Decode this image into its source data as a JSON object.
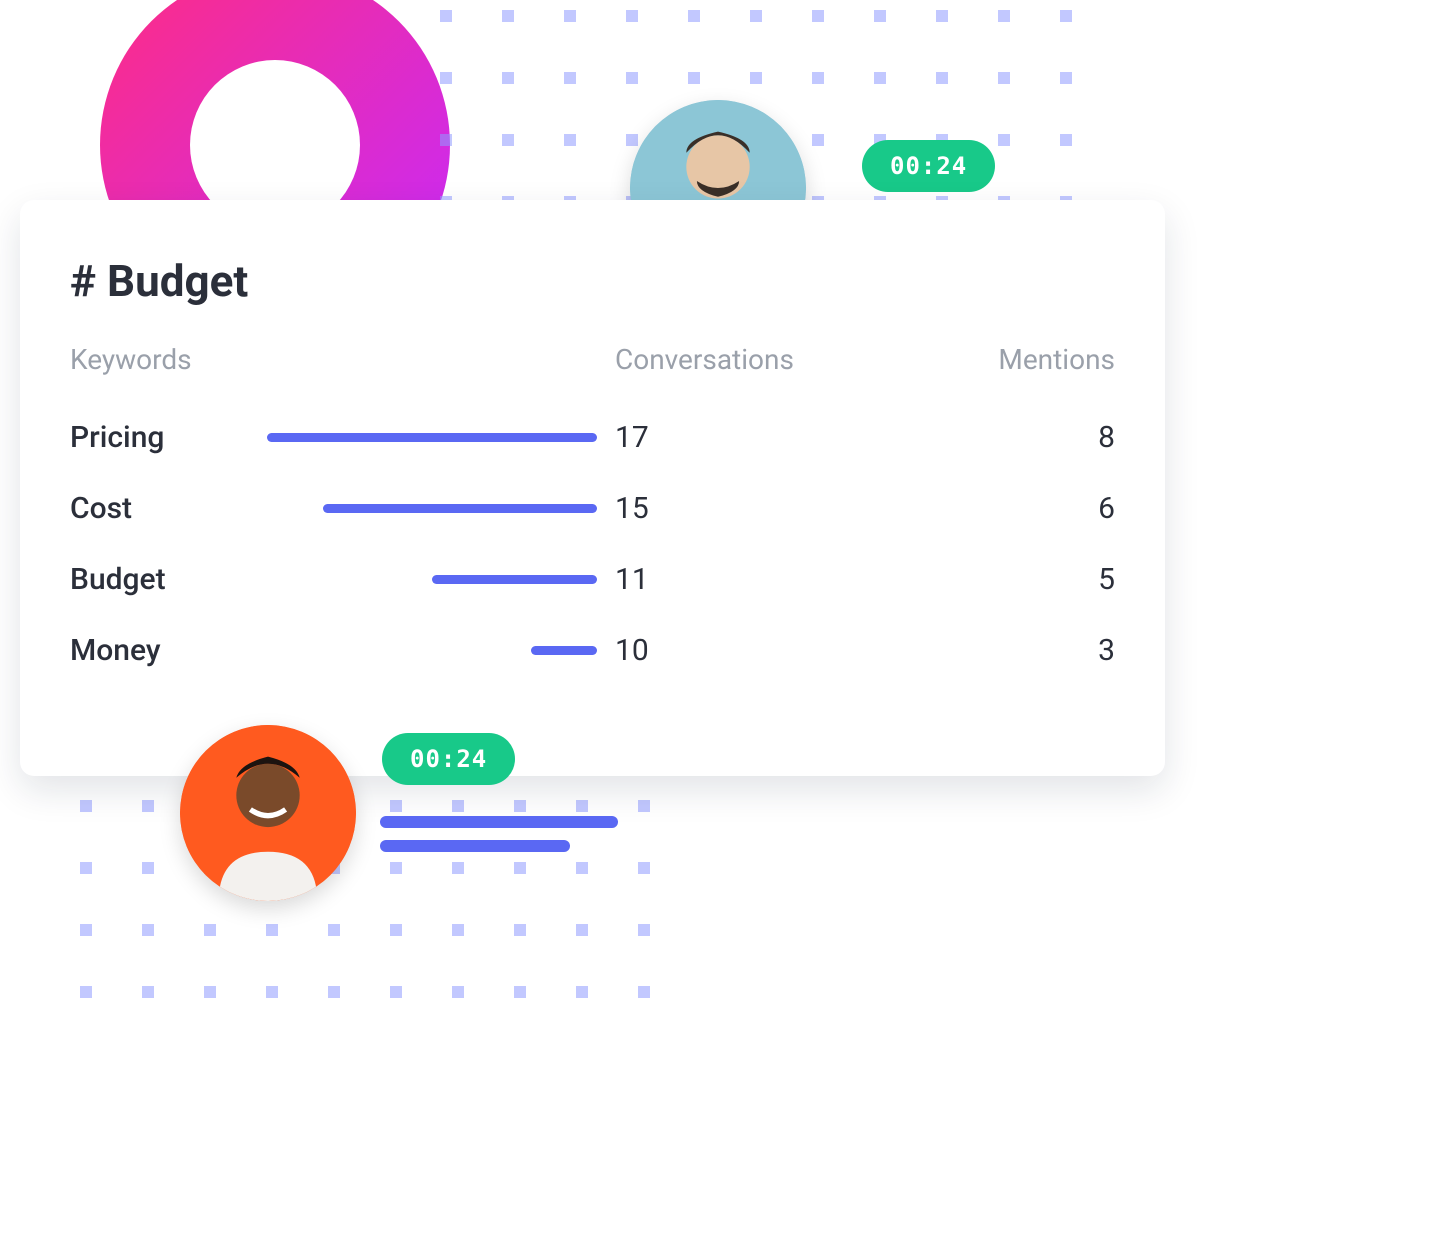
{
  "card": {
    "title": "# Budget",
    "columns": {
      "keywords": "Keywords",
      "conversations": "Conversations",
      "mentions": "Mentions"
    },
    "rows": [
      {
        "keyword": "Pricing",
        "conversations": "17",
        "mentions": "8",
        "bar_pct": 100
      },
      {
        "keyword": "Cost",
        "conversations": "15",
        "mentions": "6",
        "bar_pct": 83
      },
      {
        "keyword": "Budget",
        "conversations": "11",
        "mentions": "5",
        "bar_pct": 50
      },
      {
        "keyword": "Money",
        "conversations": "10",
        "mentions": "3",
        "bar_pct": 20
      }
    ]
  },
  "timestamps": {
    "top": "00:24",
    "bottom": "00:24"
  },
  "colors": {
    "accent": "#5a68f3",
    "pill": "#18c989",
    "ring_from": "#ff2d82",
    "ring_to": "#c52aff"
  },
  "chart_data": {
    "type": "bar",
    "title": "# Budget",
    "categories": [
      "Pricing",
      "Cost",
      "Budget",
      "Money"
    ],
    "series": [
      {
        "name": "Conversations",
        "values": [
          17,
          15,
          11,
          10
        ]
      },
      {
        "name": "Mentions",
        "values": [
          8,
          6,
          5,
          3
        ]
      }
    ],
    "xlabel": "Keywords",
    "ylabel": "",
    "ylim": [
      0,
      20
    ]
  }
}
